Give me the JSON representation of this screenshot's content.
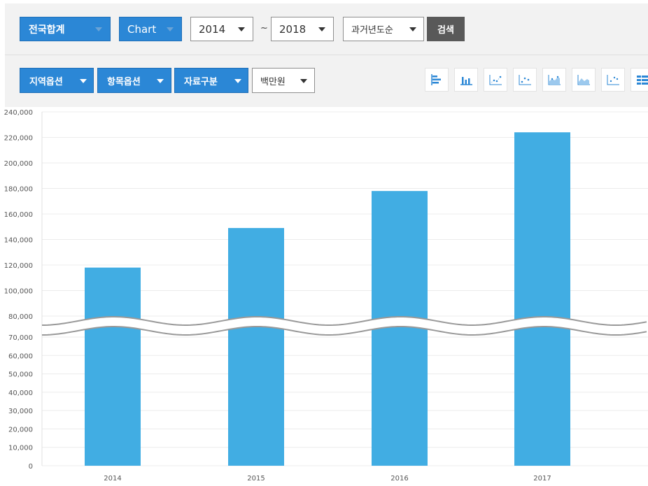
{
  "toolbar": {
    "region_select": {
      "label": "전국합계"
    },
    "view_select": {
      "label": "Chart"
    },
    "year_from": {
      "value": "2014"
    },
    "range_separator": "~",
    "year_to": {
      "value": "2018"
    },
    "sort_select": {
      "value": "과거년도순"
    },
    "search_button": "검색",
    "region_options": "지역옵션",
    "item_options": "항목옵션",
    "data_category": "자료구분",
    "unit_select": {
      "value": "백만원"
    },
    "chart_type_icons": [
      "horizontal-bar-chart-icon",
      "vertical-bar-chart-icon",
      "scatter-chart-icon",
      "scatter-line-chart-icon",
      "area-bar-chart-icon",
      "area-chart-icon",
      "dot-chart-icon",
      "table-chart-icon"
    ]
  },
  "colors": {
    "accent": "#2b87d6",
    "bar": "#41ade3",
    "search_button": "#595959",
    "toolbar_bg": "#f2f2f2"
  },
  "chart_data": {
    "type": "bar",
    "categories": [
      "2014",
      "2015",
      "2016",
      "2017"
    ],
    "values": [
      118000,
      149000,
      178000,
      224000
    ],
    "title": "",
    "xlabel": "",
    "ylabel": "",
    "y_ticks_upper": [
      "240,000",
      "220,000",
      "200,000",
      "180,000",
      "160,000",
      "140,000",
      "120,000",
      "100,000",
      "80,000"
    ],
    "y_ticks_lower": [
      "70,000",
      "60,000",
      "50,000",
      "40,000",
      "30,000",
      "20,000",
      "10,000",
      "0"
    ],
    "upper_range": [
      80000,
      240000
    ],
    "lower_range": [
      0,
      70000
    ],
    "broken_axis": true,
    "grid": true
  }
}
